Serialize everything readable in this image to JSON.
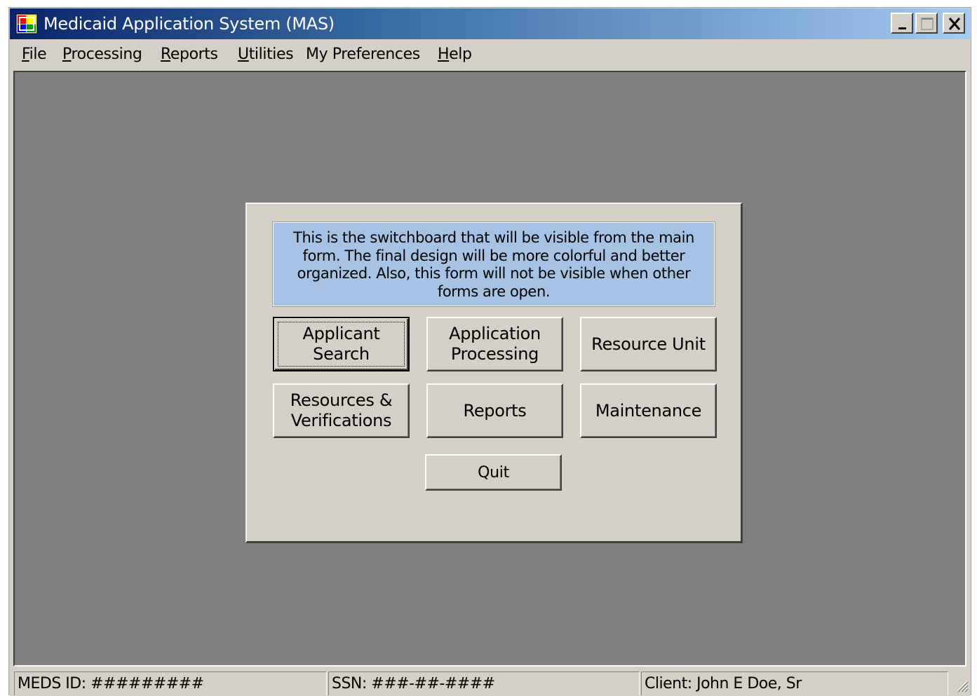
{
  "window": {
    "title": "Medicaid Application System (MAS)",
    "icon": "app-window-icon",
    "controls": [
      "minimize-icon",
      "maximize-icon",
      "close-icon"
    ]
  },
  "menu": {
    "items": [
      {
        "accel": "F",
        "rest": "ile"
      },
      {
        "accel": "P",
        "rest": "rocessing"
      },
      {
        "accel": "R",
        "rest": "eports"
      },
      {
        "accel": "U",
        "rest": "tilities"
      },
      {
        "accel": "",
        "rest": "My Preferences"
      },
      {
        "accel": "H",
        "rest": "elp"
      }
    ]
  },
  "switchboard": {
    "note": "This is the switchboard that will be visible from the main form.  The final design will be more colorful and better organized.  Also, this form will not be visible when other forms are open.",
    "buttons": [
      {
        "label": "Applicant\nSearch"
      },
      {
        "label": "Application\nProcessing"
      },
      {
        "label": "Resource Unit"
      },
      {
        "label": "Resources &\nVerifications"
      },
      {
        "label": "Reports"
      },
      {
        "label": "Maintenance"
      }
    ],
    "quit_label": "Quit"
  },
  "status": {
    "meds_id": "MEDS ID:  #########",
    "ssn": "SSN:  ###-##-####",
    "client": "Client:  John E Doe, Sr"
  },
  "colors": {
    "title_gradient_start": "#0a246a",
    "title_gradient_end": "#a6caf0",
    "face": "#d4d0c8",
    "mdi_background": "#808080",
    "note_background": "#a6c3e6"
  }
}
